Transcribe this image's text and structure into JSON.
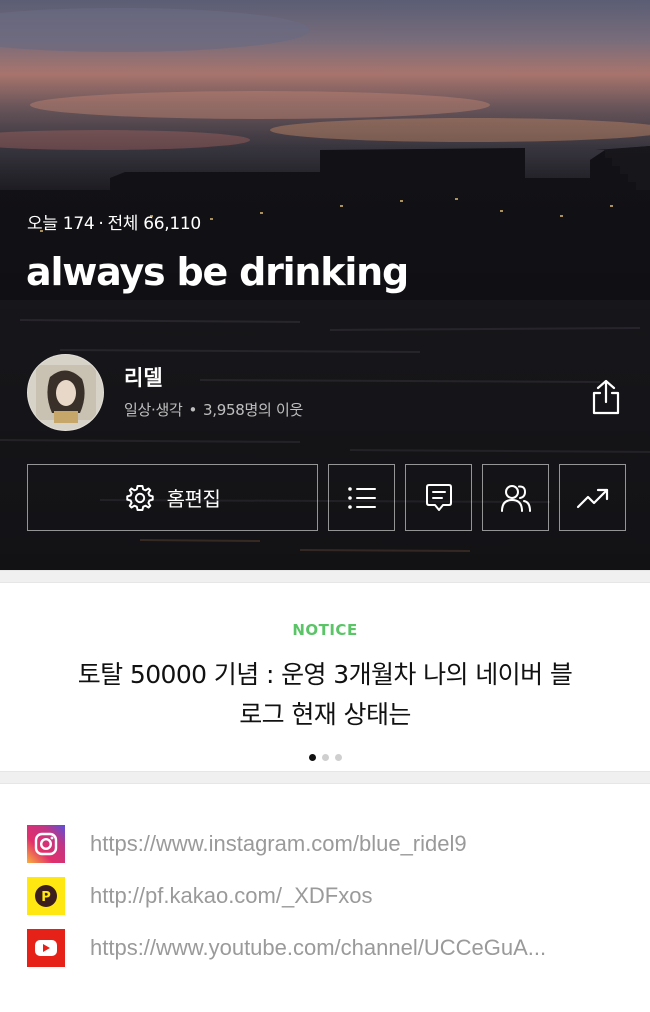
{
  "hero": {
    "visitor_today_label": "오늘",
    "visitor_today": "174",
    "visitor_total_label": "전체",
    "visitor_total": "66,110",
    "blog_title": "always be drinking",
    "nickname": "리델",
    "category": "일상·생각",
    "neighbors": "3,958명의 이웃",
    "edit_button_label": "홈편집",
    "buttons": [
      {
        "icon": "gear-icon",
        "label": "홈편집"
      },
      {
        "icon": "list-icon"
      },
      {
        "icon": "comment-icon"
      },
      {
        "icon": "neighbors-icon"
      },
      {
        "icon": "stats-trend-icon"
      }
    ],
    "share_icon": "share-icon"
  },
  "notice": {
    "label": "NOTICE",
    "title": "토탈 50000 기념 : 운영 3개월차 나의 네이버 블로그 현재 상태는",
    "pages": 3,
    "active_page": 1
  },
  "links": [
    {
      "icon": "instagram-icon",
      "url": "https://www.instagram.com/blue_ridel9",
      "color": "#c13584"
    },
    {
      "icon": "kakao-plus-icon",
      "url": "http://pf.kakao.com/_XDFxos",
      "color": "#ffe812"
    },
    {
      "icon": "youtube-icon",
      "url": "https://www.youtube.com/channel/UCCeGuA...",
      "color": "#e62117"
    }
  ],
  "colors": {
    "notice_accent": "#5ac467",
    "link_text": "#9a9a9a"
  }
}
